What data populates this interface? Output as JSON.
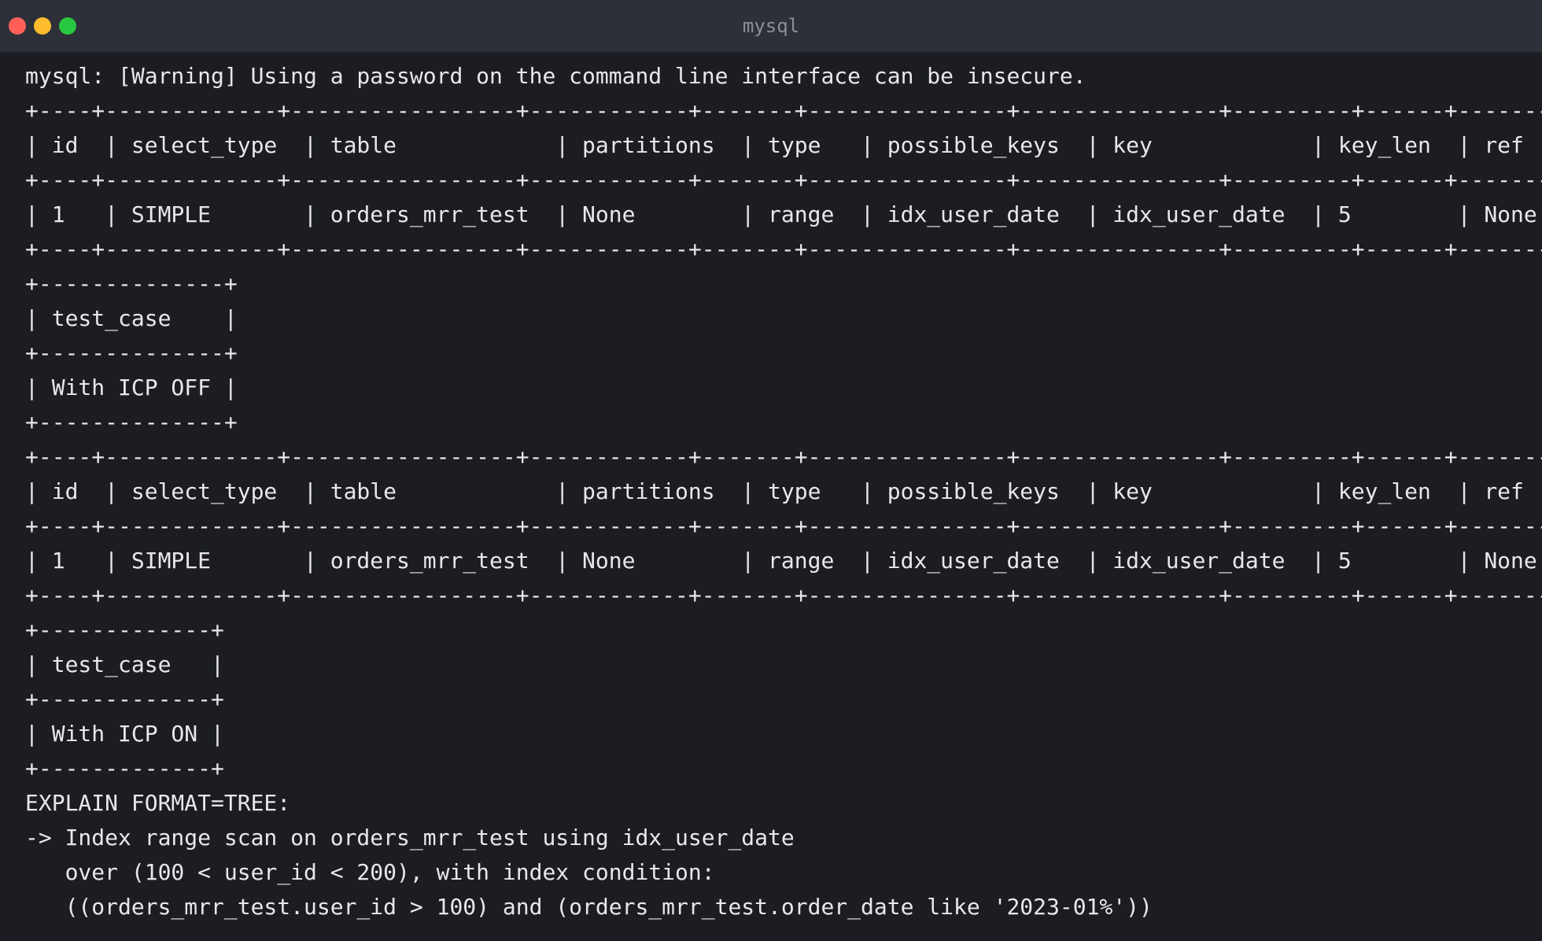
{
  "window": {
    "title": "mysql",
    "traffic_lights": {
      "close_color": "#ff5f57",
      "minimize_color": "#febc2e",
      "maximize_color": "#28c840"
    }
  },
  "terminal": {
    "lines": [
      "mysql: [Warning] Using a password on the command line interface can be insecure.",
      "+----+-------------+-----------------+------------+-------+---------------+---------------+---------+------+-------",
      "| id  | select_type  | table            | partitions  | type   | possible_keys  | key            | key_len  | ref",
      "+----+-------------+-----------------+------------+-------+---------------+---------------+---------+------+-------",
      "| 1   | SIMPLE       | orders_mrr_test  | None        | range  | idx_user_date  | idx_user_date  | 5        | None",
      "+----+-------------+-----------------+------------+-------+---------------+---------------+---------+------+-------",
      "+--------------+",
      "| test_case    |",
      "+--------------+",
      "| With ICP OFF |",
      "+--------------+",
      "+----+-------------+-----------------+------------+-------+---------------+---------------+---------+------+-------",
      "| id  | select_type  | table            | partitions  | type   | possible_keys  | key            | key_len  | ref",
      "+----+-------------+-----------------+------------+-------+---------------+---------------+---------+------+-------",
      "| 1   | SIMPLE       | orders_mrr_test  | None        | range  | idx_user_date  | idx_user_date  | 5        | None",
      "+----+-------------+-----------------+------------+-------+---------------+---------------+---------+------+-------",
      "+-------------+",
      "| test_case   |",
      "+-------------+",
      "| With ICP ON |",
      "+-------------+",
      "EXPLAIN FORMAT=TREE:",
      "-> Index range scan on orders_mrr_test using idx_user_date",
      "   over (100 < user_id < 200), with index condition:",
      "   ((orders_mrr_test.user_id > 100) and (orders_mrr_test.order_date like '2023-01%'))"
    ]
  }
}
